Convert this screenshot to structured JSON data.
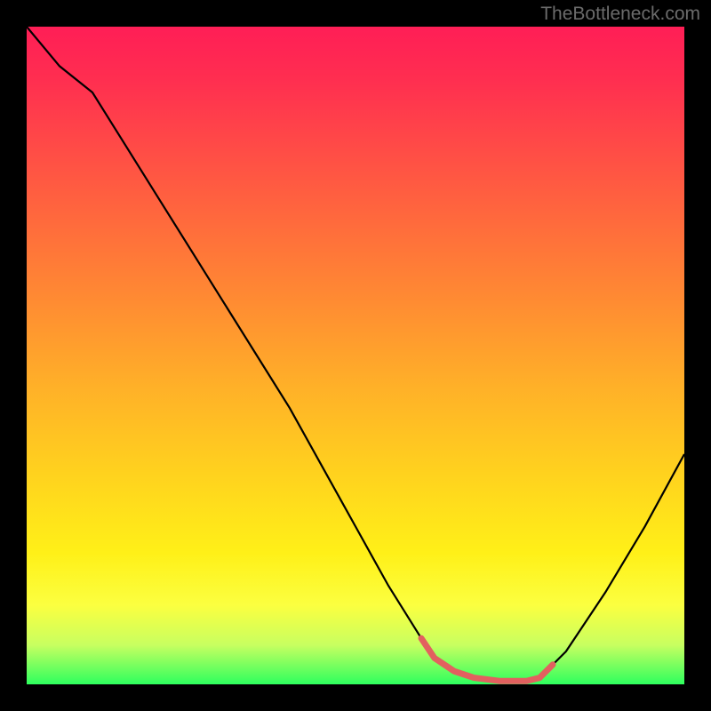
{
  "watermark": "TheBottleneck.com",
  "chart_data": {
    "type": "line",
    "title": "",
    "xlabel": "",
    "ylabel": "",
    "xlim": [
      0,
      100
    ],
    "ylim": [
      0,
      100
    ],
    "grid": false,
    "series": [
      {
        "name": "main-curve",
        "color": "#000000",
        "x": [
          0,
          5,
          10,
          15,
          20,
          25,
          30,
          35,
          40,
          45,
          50,
          55,
          60,
          62,
          65,
          68,
          72,
          76,
          78,
          82,
          88,
          94,
          100
        ],
        "y": [
          100,
          94,
          90,
          82,
          74,
          66,
          58,
          50,
          42,
          33,
          24,
          15,
          7,
          4,
          2,
          1,
          0.5,
          0.5,
          1,
          5,
          14,
          24,
          35
        ]
      },
      {
        "name": "highlight-segment",
        "color": "#e2605f",
        "x": [
          60,
          62,
          65,
          68,
          72,
          76,
          78,
          80
        ],
        "y": [
          7,
          4,
          2,
          1,
          0.5,
          0.5,
          1,
          3
        ]
      }
    ],
    "background_gradient": {
      "top": "#ff1e56",
      "mid": "#ffd21e",
      "bottom": "#2eff5e"
    }
  }
}
